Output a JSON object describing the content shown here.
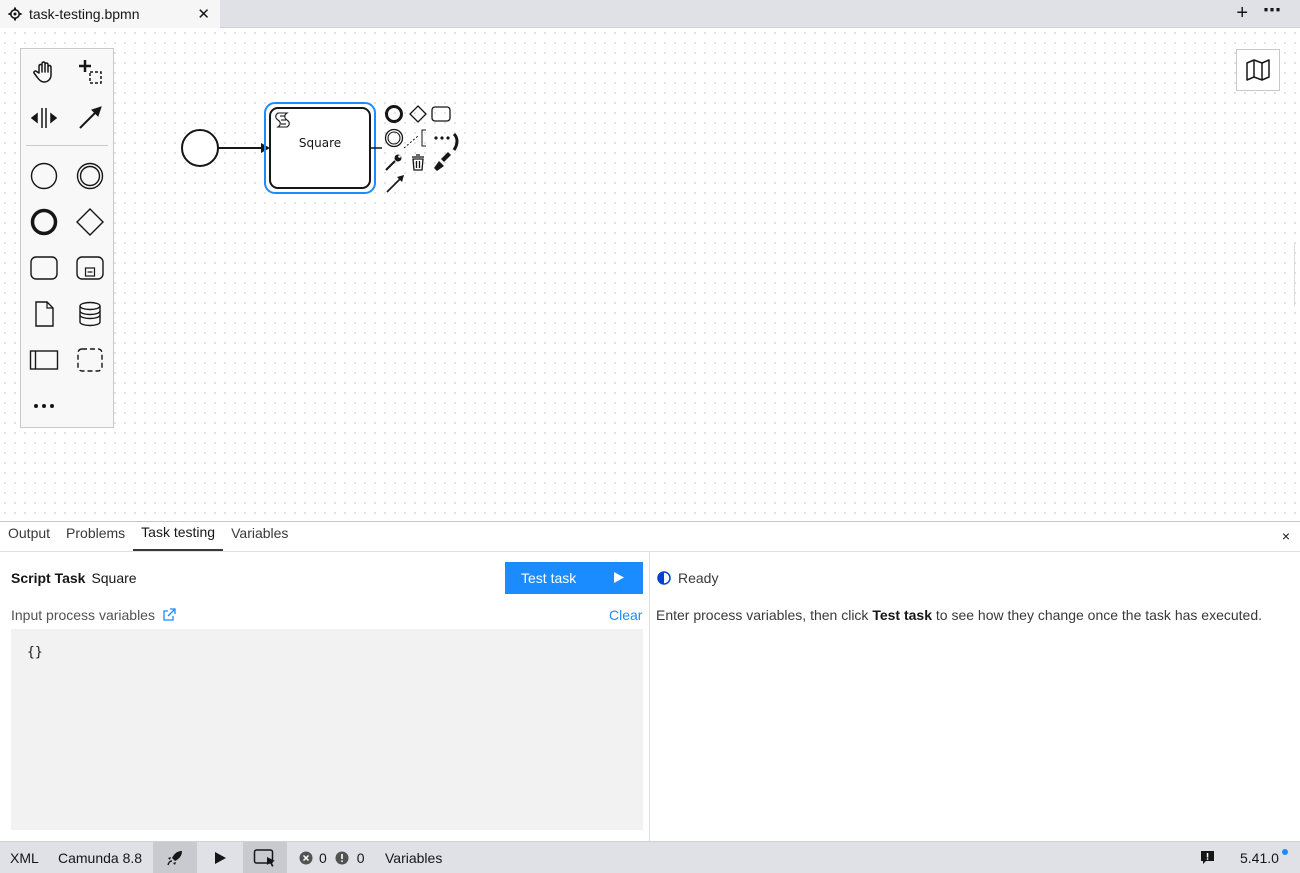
{
  "tab": {
    "title": "task-testing.bpmn",
    "close_icon": "x-icon"
  },
  "tabbar": {
    "add_icon": "plus-icon",
    "more_icon": "more-icon",
    "add_glyph": "+",
    "more_glyph": "⋯"
  },
  "diagram": {
    "task_label": "Square"
  },
  "panel": {
    "tabs": [
      "Output",
      "Problems",
      "Task testing",
      "Variables"
    ],
    "active_tab": "Task testing",
    "close_glyph": "×",
    "task_type": "Script Task",
    "task_name": "Square",
    "test_button_label": "Test task",
    "input_label": "Input process variables",
    "clear_label": "Clear",
    "editor_value": "{}",
    "status_label": "Ready",
    "help_before": "Enter process variables, then click ",
    "help_bold": "Test task",
    "help_after": " to see how they change once the task has executed."
  },
  "statusbar": {
    "xml_label": "XML",
    "engine_label": "Camunda 8.8",
    "errors_count": "0",
    "warnings_count": "0",
    "variables_label": "Variables",
    "version": "5.41.0"
  },
  "colors": {
    "accent": "#1a8cff",
    "selection": "#1a8cff"
  }
}
